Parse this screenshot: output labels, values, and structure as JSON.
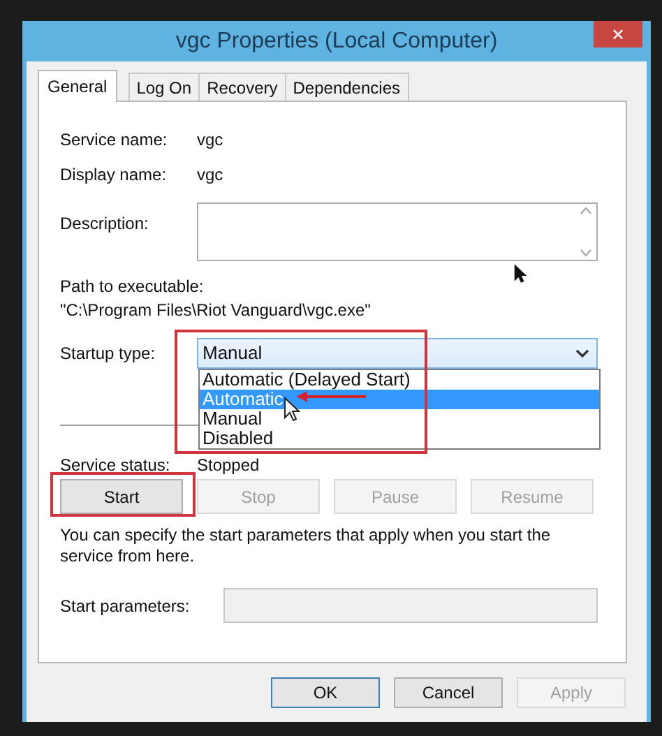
{
  "window": {
    "title": "vgc Properties (Local Computer)",
    "close": "✕"
  },
  "tabs": [
    {
      "label": "General",
      "selected": true
    },
    {
      "label": "Log On",
      "selected": false
    },
    {
      "label": "Recovery",
      "selected": false
    },
    {
      "label": "Dependencies",
      "selected": false
    }
  ],
  "fields": [
    {
      "label": "Service name:",
      "value": "vgc"
    },
    {
      "label": "Display name:",
      "value": "vgc"
    }
  ],
  "description": {
    "label": "Description:"
  },
  "path": {
    "label": "Path to executable:",
    "value": "\"C:\\Program Files\\Riot Vanguard\\vgc.exe\""
  },
  "startup_type": {
    "label": "Startup type:",
    "value": "Manual",
    "expanded": true,
    "options": [
      {
        "label": "Automatic (Delayed Start)",
        "highlighted": false
      },
      {
        "label": "Automatic",
        "highlighted": true
      },
      {
        "label": "Manual",
        "highlighted": false
      },
      {
        "label": "Disabled",
        "highlighted": false
      }
    ]
  },
  "service_status": {
    "label": "Service status:",
    "value": "Stopped"
  },
  "service_buttons": [
    {
      "label": "Start",
      "disabled": false
    },
    {
      "label": "Stop",
      "disabled": true
    },
    {
      "label": "Pause",
      "disabled": true
    },
    {
      "label": "Resume",
      "disabled": true
    }
  ],
  "hint": "You can specify the start parameters that apply when you start the service from here.",
  "start_parameters": {
    "label": "Start parameters:"
  },
  "dialog_buttons": [
    {
      "label": "OK",
      "default": true,
      "disabled": false
    },
    {
      "label": "Cancel",
      "default": false,
      "disabled": false
    },
    {
      "label": "Apply",
      "default": false,
      "disabled": true
    }
  ]
}
